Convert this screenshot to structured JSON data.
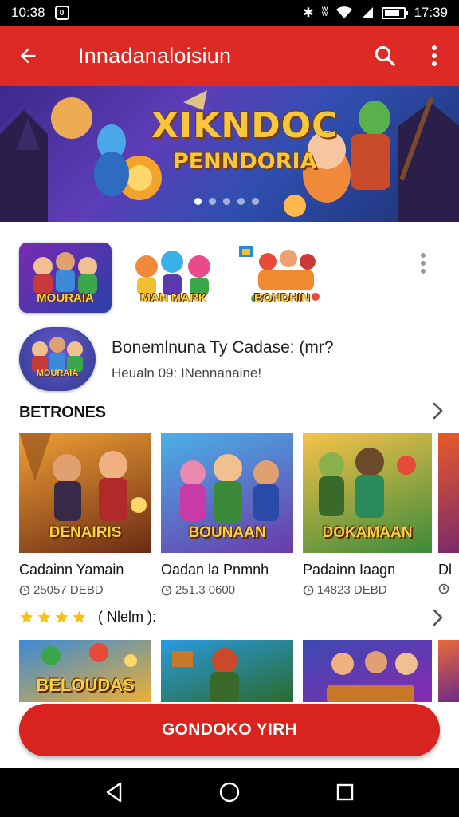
{
  "status_bar": {
    "time_left": "10:38",
    "time_right": "17:39"
  },
  "app_bar": {
    "title": "Innadanaloisiun",
    "back_icon": "arrow-back-icon",
    "search_icon": "search-icon",
    "menu_icon": "more-vert-icon"
  },
  "banner": {
    "title_line1": "XIKNDOC",
    "title_line2": "PENNDORIA",
    "dots_count": 5,
    "active_dot": 1
  },
  "thumbnails": [
    {
      "label": "MOURAIA",
      "bg": [
        "#7a2ab0",
        "#2b3fa8"
      ]
    },
    {
      "label": "MAN MARK",
      "bg": [
        "#ffffff",
        "#ffffff"
      ]
    },
    {
      "label": "BONDHIN",
      "bg": [
        "#ffffff",
        "#ffffff"
      ]
    }
  ],
  "featured": {
    "name": "Bonemlnuna Ty Cadase: (mr?",
    "subtitle": "Heualn 09: INennanaine!"
  },
  "section": {
    "title": "BETRONES"
  },
  "cards": [
    {
      "image_label": "DENAIRIS",
      "name": "Cadainn Yamain",
      "meta": "25057 DEBD",
      "bg": [
        "#f0a034",
        "#6a2a14"
      ]
    },
    {
      "image_label": "BOUNAAN",
      "name": "Oadan la Pnmnh",
      "meta": "251.3 0600",
      "bg": [
        "#4ab0e8",
        "#6a3aa8"
      ]
    },
    {
      "image_label": "DOKAMAAN",
      "name": "Padainn Iaagn",
      "meta": "14823 DEBD",
      "bg": [
        "#f7c24a",
        "#3a8a3a"
      ]
    },
    {
      "image_label": "",
      "name": "Dl",
      "meta": "",
      "bg": [
        "#e85a2a",
        "#7a2a6a"
      ]
    }
  ],
  "rating": {
    "stars": 4,
    "text": "( Nlelm ):"
  },
  "cards_row2": [
    {
      "image_label": "BELOUDAS",
      "bg": [
        "#3a8ad8",
        "#f0b030"
      ]
    },
    {
      "image_label": "",
      "bg": [
        "#2a9ae0",
        "#2a6a2a"
      ]
    },
    {
      "image_label": "",
      "bg": [
        "#3a4ab0",
        "#8a2ab0"
      ]
    },
    {
      "image_label": "",
      "bg": [
        "#e86a3a",
        "#6a2a8a"
      ]
    }
  ],
  "cta": {
    "label": "GONDOKO YIRH"
  },
  "colors": {
    "brand_red": "#de2a24",
    "cta_red": "#d8231f"
  }
}
